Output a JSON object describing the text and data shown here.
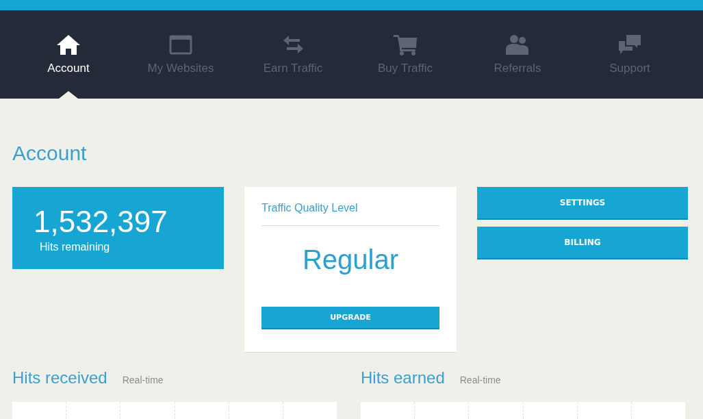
{
  "nav": {
    "tabs": [
      {
        "label": "Account",
        "selected": true
      },
      {
        "label": "My Websites",
        "selected": false
      },
      {
        "label": "Earn Traffic",
        "selected": false
      },
      {
        "label": "Buy Traffic",
        "selected": false
      },
      {
        "label": "Referrals",
        "selected": false
      },
      {
        "label": "Support",
        "selected": false
      }
    ]
  },
  "page_title": "Account",
  "hits_card": {
    "value": "1,532,397",
    "label": "Hits remaining"
  },
  "quality_card": {
    "title": "Traffic Quality Level",
    "level_name": "Regular",
    "button": "UPGRADE"
  },
  "actions": [
    "SETTINGS",
    "BILLING"
  ],
  "charts": [
    {
      "title": "Hits received",
      "subtitle": "Real-time"
    },
    {
      "title": "Hits earned",
      "subtitle": "Real-time"
    }
  ]
}
